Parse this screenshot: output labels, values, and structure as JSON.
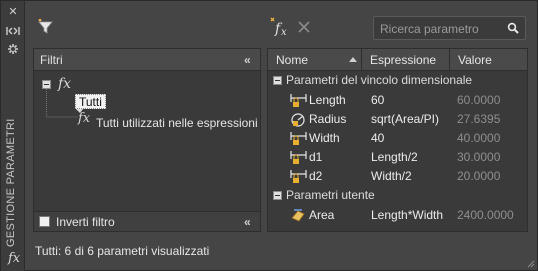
{
  "palette": {
    "label": "GESTIONE PARAMETRI",
    "strip_fx": "fx",
    "strip_icons": [
      "close-icon",
      "collapse-panel-icon",
      "settings-icon"
    ]
  },
  "toolbar": {
    "search_placeholder": "Ricerca parametro",
    "icons": [
      "new-filter-icon",
      "new-user-parameter-icon",
      "delete-parameter-icon",
      "search-icon"
    ]
  },
  "filters": {
    "title": "Filtri",
    "tree": {
      "root": {
        "fx": "fx",
        "label": "Tutti"
      },
      "child": {
        "fx": "fx",
        "label": "Tutti utilizzati nelle espressioni"
      }
    },
    "invert_label": "Inverti filtro",
    "invert_checked": false
  },
  "grid": {
    "columns": [
      "Nome",
      "Espressione",
      "Valore"
    ],
    "sort_column": "Nome",
    "sort_direction": "ascending",
    "groups": [
      {
        "label": "Parametri del vincolo dimensionale",
        "rows": [
          {
            "icon": "linear-dimension-lock-icon",
            "name": "Length",
            "expression": "60",
            "value": "60.0000"
          },
          {
            "icon": "radial-dimension-icon",
            "name": "Radius",
            "expression": "sqrt(Area/PI)",
            "value": "27.6395"
          },
          {
            "icon": "linear-dimension-lock-icon",
            "name": "Width",
            "expression": "40",
            "value": "40.0000"
          },
          {
            "icon": "linear-dimension-lock-icon",
            "name": "d1",
            "expression": "Length/2",
            "value": "30.0000"
          },
          {
            "icon": "linear-dimension-lock-icon",
            "name": "d2",
            "expression": "Width/2",
            "value": "20.0000"
          }
        ]
      },
      {
        "label": "Parametri utente",
        "rows": [
          {
            "icon": "user-parameter-icon",
            "name": "Area",
            "expression": "Length*Width",
            "value": "2400.0000"
          }
        ]
      }
    ]
  },
  "status": "Tutti: 6 di 6 parametri visualizzati"
}
